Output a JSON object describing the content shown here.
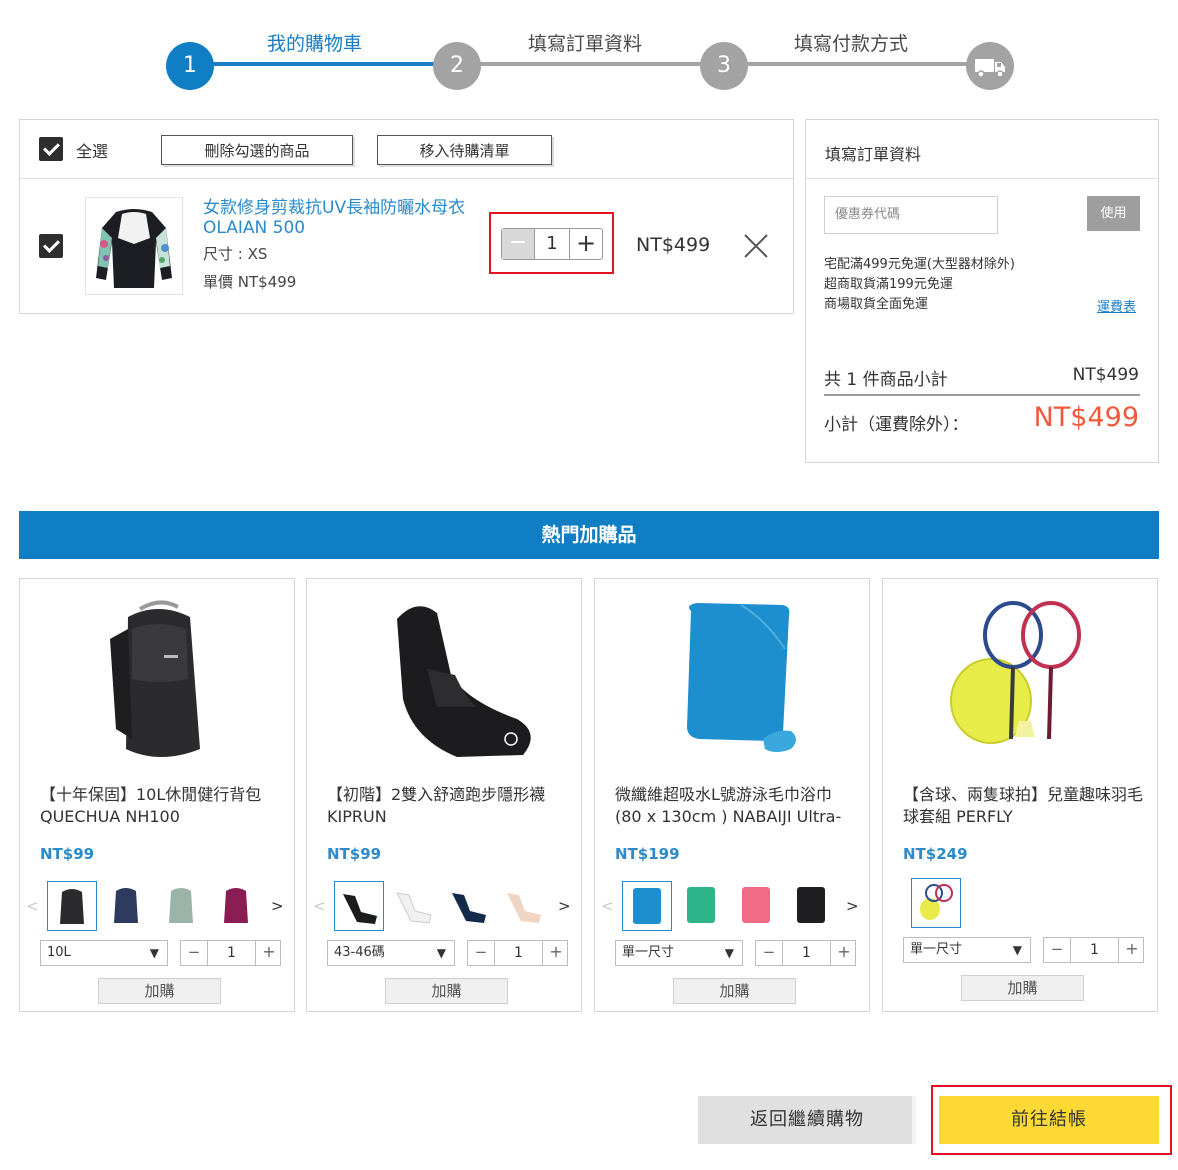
{
  "stepper": {
    "steps": [
      {
        "number": "1",
        "label": "我的購物車",
        "active": true
      },
      {
        "number": "2",
        "label": "填寫訂單資料",
        "active": false
      },
      {
        "number": "3",
        "label": "填寫付款方式",
        "active": false
      }
    ],
    "final_icon": "delivery-truck-icon"
  },
  "cart": {
    "select_all_label": "全選",
    "delete_selected_label": "刪除勾選的商品",
    "move_to_wishlist_label": "移入待購清單",
    "items": [
      {
        "name": "女款修身剪裁抗UV長袖防曬水母衣 OLAIAN 500",
        "size": "尺寸 : XS",
        "unit_price": "單價 NT$499",
        "quantity": "1",
        "price": "NT$499",
        "checked": true
      }
    ]
  },
  "summary": {
    "title": "填寫訂單資料",
    "coupon_placeholder": "優惠券代碼",
    "coupon_button": "使用",
    "shipping_notes": [
      "宅配滿499元免運(大型器材除外)",
      "超商取貨滿199元免運",
      "商場取貨全面免運"
    ],
    "shipping_link": "運費表",
    "count_label": "共 1 件商品小計",
    "count_value": "NT$499",
    "subtotal_label": "小計（運費除外）：",
    "subtotal_value": "NT$499"
  },
  "addons": {
    "title": "熱門加購品",
    "add_label": "加購",
    "products": [
      {
        "name": "【十年保固】10L休閒健行背包 QUECHUA NH100",
        "price": "NT$99",
        "variant": "10L",
        "quantity": "1"
      },
      {
        "name": "【初階】2雙入舒適跑步隱形襪 KIPRUN",
        "price": "NT$99",
        "variant": "43-46碼",
        "quantity": "1"
      },
      {
        "name": "微纖維超吸水L號游泳毛巾浴巾 (80 x 130cm ) NABAIJI Ultra-",
        "price": "NT$199",
        "variant": "單一尺寸",
        "quantity": "1"
      },
      {
        "name": "【含球、兩隻球拍】兒童趣味羽毛球套組 PERFLY",
        "price": "NT$249",
        "variant": "單一尺寸",
        "quantity": "1"
      }
    ]
  },
  "actions": {
    "back_label": "返回繼續購物",
    "checkout_label": "前往結帳"
  },
  "colors": {
    "brand_blue": "#0f7ec4",
    "price_red": "#f05a3a",
    "checkout_yellow": "#fcd934",
    "highlight_red": "#e3141f"
  }
}
